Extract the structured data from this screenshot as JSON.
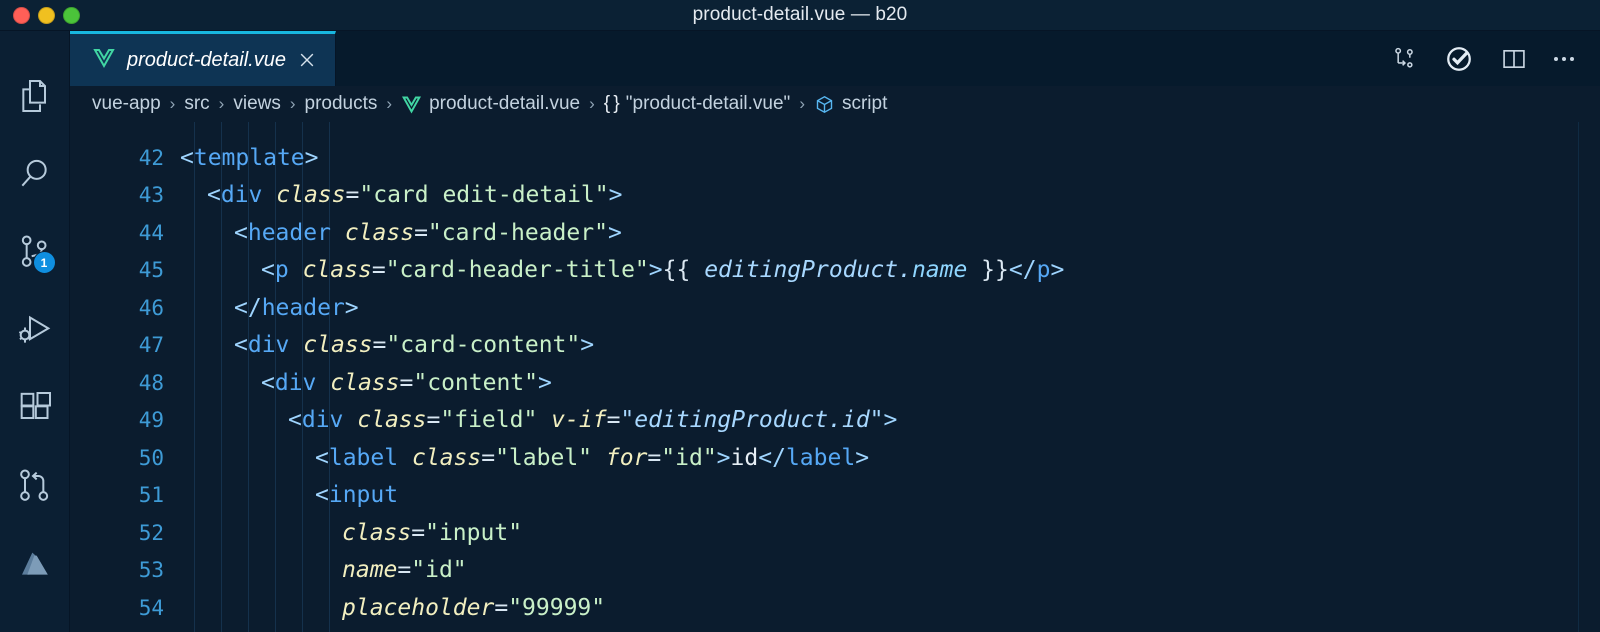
{
  "window": {
    "title": "product-detail.vue — b20",
    "controls": [
      "close",
      "minimize",
      "zoom"
    ]
  },
  "activity_bar": {
    "items": [
      {
        "name": "explorer",
        "icon": "files-icon",
        "badge": null
      },
      {
        "name": "search",
        "icon": "search-icon",
        "badge": null
      },
      {
        "name": "source-control",
        "icon": "source-control-icon",
        "badge": "1"
      },
      {
        "name": "run-and-debug",
        "icon": "run-debug-icon",
        "badge": null
      },
      {
        "name": "extensions",
        "icon": "extensions-icon",
        "badge": null
      },
      {
        "name": "pull-requests",
        "icon": "git-pull-request-icon",
        "badge": null
      },
      {
        "name": "azure",
        "icon": "azure-icon",
        "badge": null
      }
    ]
  },
  "tabs": [
    {
      "label": "product-detail.vue",
      "icon": "vue-file-icon",
      "active": true,
      "preview": true,
      "close_label": "×"
    }
  ],
  "editor_actions": [
    {
      "name": "compare-changes",
      "icon": "compare-icon"
    },
    {
      "name": "toggle-checks",
      "icon": "check-circle-icon"
    },
    {
      "name": "split-editor",
      "icon": "split-editor-icon"
    },
    {
      "name": "more-actions",
      "icon": "ellipsis-icon"
    }
  ],
  "breadcrumbs": [
    {
      "label": "vue-app",
      "icon": null
    },
    {
      "label": "src",
      "icon": null
    },
    {
      "label": "views",
      "icon": null
    },
    {
      "label": "products",
      "icon": null
    },
    {
      "label": "product-detail.vue",
      "icon": "vue-file-icon"
    },
    {
      "label": "\"product-detail.vue\"",
      "icon": "braces-icon"
    },
    {
      "label": "script",
      "icon": "module-cube-icon"
    }
  ],
  "editor": {
    "language": "vue",
    "first_visible_line": 42,
    "ghost_line": "  ",
    "lines": [
      {
        "number": "42",
        "indent": 0,
        "tokens": [
          {
            "t": "<",
            "c": "pnk"
          },
          {
            "t": "template",
            "c": "tag"
          },
          {
            "t": ">",
            "c": "pnk"
          }
        ]
      },
      {
        "number": "43",
        "indent": 1,
        "tokens": [
          {
            "t": "<",
            "c": "pnk"
          },
          {
            "t": "div",
            "c": "tag"
          },
          {
            "t": " ",
            "c": "txt"
          },
          {
            "t": "class",
            "c": "attr"
          },
          {
            "t": "=",
            "c": "eq"
          },
          {
            "t": "\"card edit-detail\"",
            "c": "str"
          },
          {
            "t": ">",
            "c": "pnk"
          }
        ]
      },
      {
        "number": "44",
        "indent": 2,
        "tokens": [
          {
            "t": "<",
            "c": "pnk"
          },
          {
            "t": "header",
            "c": "tag"
          },
          {
            "t": " ",
            "c": "txt"
          },
          {
            "t": "class",
            "c": "attr"
          },
          {
            "t": "=",
            "c": "eq"
          },
          {
            "t": "\"card-header\"",
            "c": "str"
          },
          {
            "t": ">",
            "c": "pnk"
          }
        ]
      },
      {
        "number": "45",
        "indent": 3,
        "tokens": [
          {
            "t": "<",
            "c": "pnk"
          },
          {
            "t": "p",
            "c": "tag"
          },
          {
            "t": " ",
            "c": "txt"
          },
          {
            "t": "class",
            "c": "attr"
          },
          {
            "t": "=",
            "c": "eq"
          },
          {
            "t": "\"card-header-title\"",
            "c": "str"
          },
          {
            "t": ">",
            "c": "pnk"
          },
          {
            "t": "{{ ",
            "c": "mus"
          },
          {
            "t": "editingProduct",
            "c": "expr"
          },
          {
            "t": ".",
            "c": "expr"
          },
          {
            "t": "name",
            "c": "exprv"
          },
          {
            "t": " }}",
            "c": "mus"
          },
          {
            "t": "</",
            "c": "pnk"
          },
          {
            "t": "p",
            "c": "tag"
          },
          {
            "t": ">",
            "c": "pnk"
          }
        ]
      },
      {
        "number": "46",
        "indent": 2,
        "tokens": [
          {
            "t": "</",
            "c": "pnk"
          },
          {
            "t": "header",
            "c": "tag"
          },
          {
            "t": ">",
            "c": "pnk"
          }
        ]
      },
      {
        "number": "47",
        "indent": 2,
        "tokens": [
          {
            "t": "<",
            "c": "pnk"
          },
          {
            "t": "div",
            "c": "tag"
          },
          {
            "t": " ",
            "c": "txt"
          },
          {
            "t": "class",
            "c": "attr"
          },
          {
            "t": "=",
            "c": "eq"
          },
          {
            "t": "\"card-content\"",
            "c": "str"
          },
          {
            "t": ">",
            "c": "pnk"
          }
        ]
      },
      {
        "number": "48",
        "indent": 3,
        "tokens": [
          {
            "t": "<",
            "c": "pnk"
          },
          {
            "t": "div",
            "c": "tag"
          },
          {
            "t": " ",
            "c": "txt"
          },
          {
            "t": "class",
            "c": "attr"
          },
          {
            "t": "=",
            "c": "eq"
          },
          {
            "t": "\"content\"",
            "c": "str"
          },
          {
            "t": ">",
            "c": "pnk"
          }
        ]
      },
      {
        "number": "49",
        "indent": 4,
        "tokens": [
          {
            "t": "<",
            "c": "pnk"
          },
          {
            "t": "div",
            "c": "tag"
          },
          {
            "t": " ",
            "c": "txt"
          },
          {
            "t": "class",
            "c": "attr"
          },
          {
            "t": "=",
            "c": "eq"
          },
          {
            "t": "\"field\"",
            "c": "str"
          },
          {
            "t": " ",
            "c": "txt"
          },
          {
            "t": "v-if",
            "c": "attr"
          },
          {
            "t": "=",
            "c": "eq"
          },
          {
            "t": "\"editingProduct.id\"",
            "c": "expr"
          },
          {
            "t": ">",
            "c": "pnk"
          }
        ]
      },
      {
        "number": "50",
        "indent": 5,
        "tokens": [
          {
            "t": "<",
            "c": "pnk"
          },
          {
            "t": "label",
            "c": "tag"
          },
          {
            "t": " ",
            "c": "txt"
          },
          {
            "t": "class",
            "c": "attr"
          },
          {
            "t": "=",
            "c": "eq"
          },
          {
            "t": "\"label\"",
            "c": "str"
          },
          {
            "t": " ",
            "c": "txt"
          },
          {
            "t": "for",
            "c": "attr"
          },
          {
            "t": "=",
            "c": "eq"
          },
          {
            "t": "\"id\"",
            "c": "str"
          },
          {
            "t": ">",
            "c": "pnk"
          },
          {
            "t": "id",
            "c": "txt"
          },
          {
            "t": "</",
            "c": "pnk"
          },
          {
            "t": "label",
            "c": "tag"
          },
          {
            "t": ">",
            "c": "pnk"
          }
        ]
      },
      {
        "number": "51",
        "indent": 5,
        "tokens": [
          {
            "t": "<",
            "c": "pnk"
          },
          {
            "t": "input",
            "c": "tag"
          }
        ]
      },
      {
        "number": "52",
        "indent": 6,
        "tokens": [
          {
            "t": "class",
            "c": "attr"
          },
          {
            "t": "=",
            "c": "eq"
          },
          {
            "t": "\"input\"",
            "c": "str"
          }
        ]
      },
      {
        "number": "53",
        "indent": 6,
        "tokens": [
          {
            "t": "name",
            "c": "attr"
          },
          {
            "t": "=",
            "c": "eq"
          },
          {
            "t": "\"id\"",
            "c": "str"
          }
        ]
      },
      {
        "number": "54",
        "indent": 6,
        "tokens": [
          {
            "t": "placeholder",
            "c": "attr"
          },
          {
            "t": "=",
            "c": "eq"
          },
          {
            "t": "\"99999\"",
            "c": "str"
          }
        ]
      }
    ]
  },
  "colors": {
    "titlebar_bg": "#0b2134",
    "editor_bg": "#0b1c2e",
    "activitybar_bg": "#0b1f33",
    "tabbar_bg": "#061a2c",
    "active_tab_bg": "#0e3454",
    "tab_top_border": "#18b7e0",
    "line_number": "#3e9bd6",
    "badge": "#0f8fe0",
    "vue_green": "#41d6a3",
    "string": "#c9f0c8",
    "attribute": "#f2efc0",
    "tag": "#56a8f5"
  }
}
